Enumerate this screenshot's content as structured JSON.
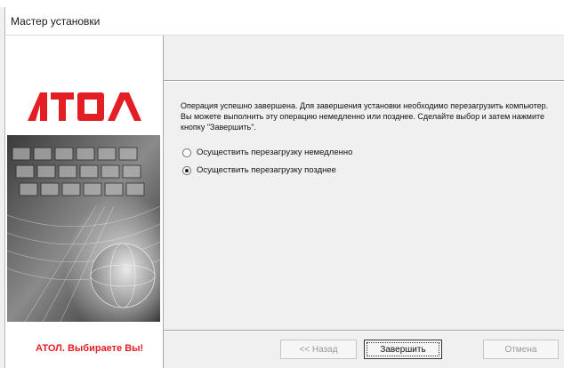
{
  "window": {
    "title": "Мастер установки"
  },
  "brand": {
    "logo_text": "ATOΛ",
    "slogan": "АТОЛ. Выбираете Вы!"
  },
  "content": {
    "message": "Операция успешно завершена. Для завершения установки необходимо перезагрузить компьютер. Вы можете выполнить эту операцию немедленно или позднее. Сделайте выбор и затем нажмите кнопку \"Завершить\".",
    "options": [
      {
        "label": "Осуществить перезагрузку немедленно",
        "checked": false
      },
      {
        "label": "Осуществить перезагрузку позднее",
        "checked": true
      }
    ]
  },
  "buttons": {
    "back": "<< Назад",
    "finish": "Завершить",
    "cancel": "Отмена"
  }
}
